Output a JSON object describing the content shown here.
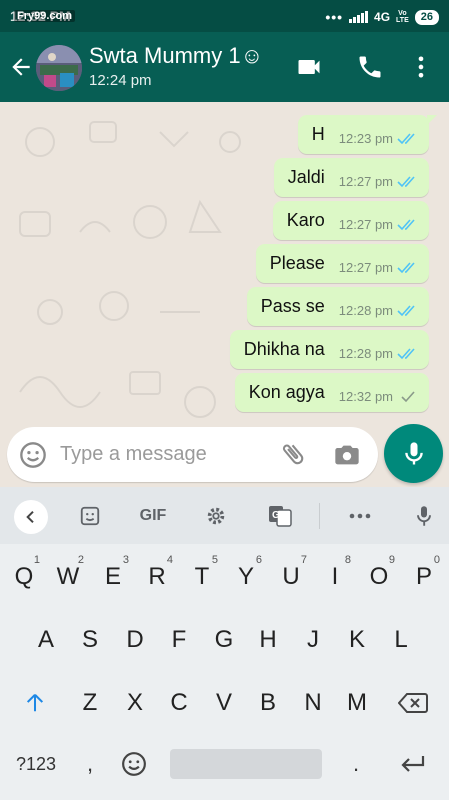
{
  "status_bar": {
    "time": "12:32 PM",
    "watermark": "Fry99.com",
    "network": "4G",
    "volte_line1": "Vo",
    "volte_line2": "LTE",
    "battery": "26"
  },
  "header": {
    "contact_name": "Swta Mummy 1☺",
    "subtitle": "12:24 pm"
  },
  "messages": [
    {
      "text": "H",
      "time": "12:23 pm",
      "status": "read"
    },
    {
      "text": "Jaldi",
      "time": "12:27 pm",
      "status": "read"
    },
    {
      "text": "Karo",
      "time": "12:27 pm",
      "status": "read"
    },
    {
      "text": "Please",
      "time": "12:27 pm",
      "status": "read"
    },
    {
      "text": "Pass se",
      "time": "12:28 pm",
      "status": "read"
    },
    {
      "text": "Dhikha na",
      "time": "12:28 pm",
      "status": "read"
    },
    {
      "text": "Kon agya",
      "time": "12:32 pm",
      "status": "sent"
    }
  ],
  "composer": {
    "placeholder": "Type a message"
  },
  "keyboard": {
    "toolbar": {
      "gif_label": "GIF"
    },
    "row1": [
      {
        "key": "Q",
        "hint": "1"
      },
      {
        "key": "W",
        "hint": "2"
      },
      {
        "key": "E",
        "hint": "3"
      },
      {
        "key": "R",
        "hint": "4"
      },
      {
        "key": "T",
        "hint": "5"
      },
      {
        "key": "Y",
        "hint": "6"
      },
      {
        "key": "U",
        "hint": "7"
      },
      {
        "key": "I",
        "hint": "8"
      },
      {
        "key": "O",
        "hint": "9"
      },
      {
        "key": "P",
        "hint": "0"
      }
    ],
    "row2": [
      "A",
      "S",
      "D",
      "F",
      "G",
      "H",
      "J",
      "K",
      "L"
    ],
    "row3": [
      "Z",
      "X",
      "C",
      "V",
      "B",
      "N",
      "M"
    ],
    "symbols_label": "?123",
    "comma": ",",
    "period": "."
  },
  "colors": {
    "header": "#075E54",
    "status_bar": "#054D44",
    "bubble_out": "#DCF8C6",
    "read_tick": "#4FC3F7",
    "accent": "#00897B"
  }
}
